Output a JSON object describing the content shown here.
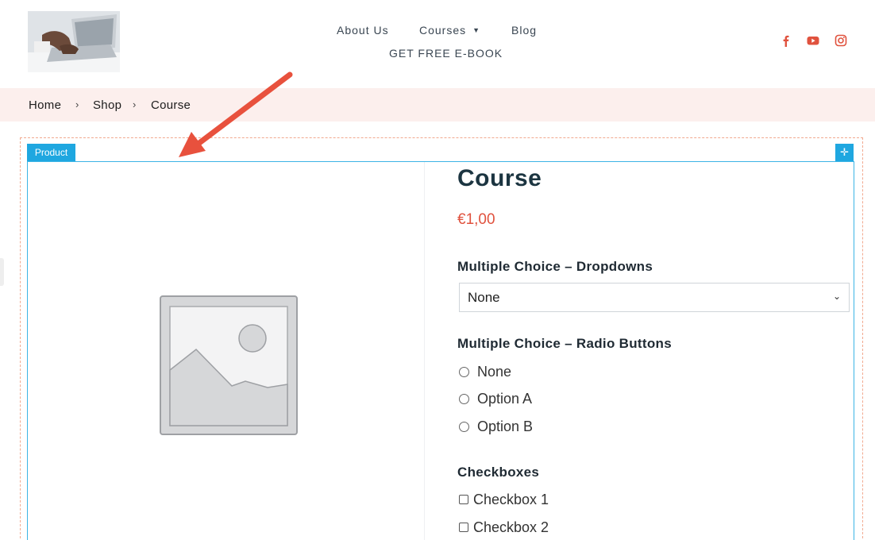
{
  "header": {
    "nav": {
      "about": "About Us",
      "courses": "Courses",
      "blog": "Blog",
      "ebook": "GET FREE E-BOOK"
    },
    "social": [
      "facebook-icon",
      "youtube-icon",
      "instagram-icon"
    ],
    "social_color": "#e0523e"
  },
  "breadcrumb": {
    "items": [
      "Home",
      "Shop",
      "Course"
    ],
    "separator": "›"
  },
  "editor": {
    "widget_label": "Product",
    "move_icon": "move-icon",
    "accent": "#1fa7e0"
  },
  "product": {
    "title": "Course",
    "price": "€1,00",
    "dropdown": {
      "label": "Multiple Choice – Dropdowns",
      "selected": "None"
    },
    "radio": {
      "label": "Multiple Choice – Radio Buttons",
      "options": [
        "None",
        "Option A",
        "Option B"
      ]
    },
    "checkboxes": {
      "label": "Checkboxes",
      "options": [
        "Checkbox 1",
        "Checkbox 2"
      ]
    }
  }
}
